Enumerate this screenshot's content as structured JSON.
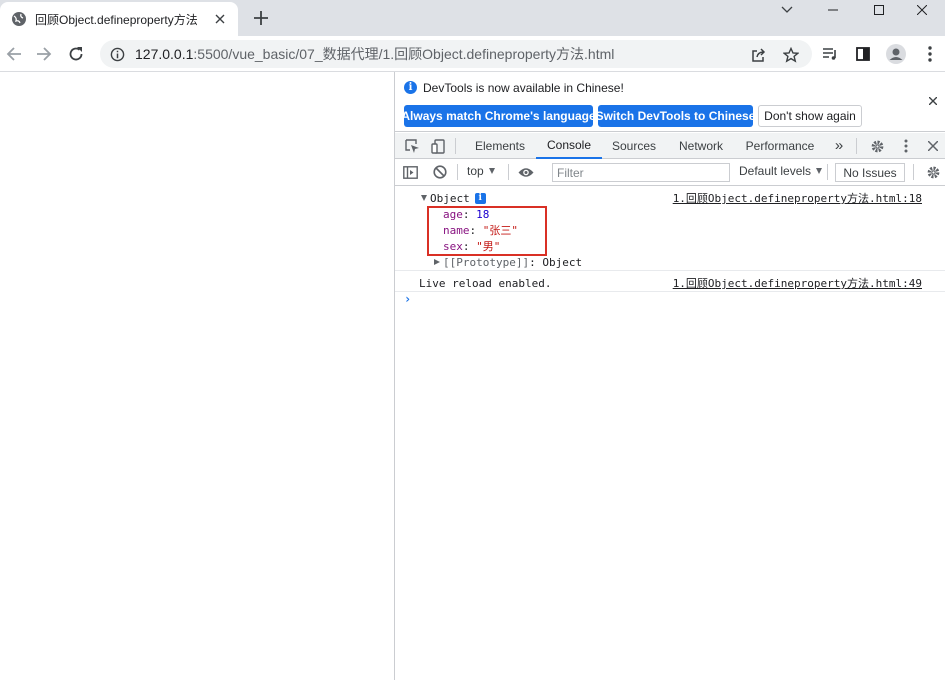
{
  "browser": {
    "tab_title": "回顾Object.defineproperty方法",
    "url_host": "127.0.0.1",
    "url_path": ":5500/vue_basic/07_数据代理/1.回顾Object.defineproperty方法.html"
  },
  "devtools": {
    "infobar": {
      "message": "DevTools is now available in Chinese!",
      "btn_match": "Always match Chrome's language",
      "btn_switch": "Switch DevTools to Chinese",
      "btn_dismiss": "Don't show again"
    },
    "tabs": [
      "Elements",
      "Console",
      "Sources",
      "Network",
      "Performance"
    ],
    "more_tabs": "»",
    "console_toolbar": {
      "context": "top",
      "filter_placeholder": "Filter",
      "levels": "Default levels",
      "issues": "No Issues"
    },
    "console": {
      "object_label": "Object",
      "info_badge": "i",
      "props": [
        {
          "key": "age",
          "value": "18",
          "kind": "num"
        },
        {
          "key": "name",
          "value": "\"张三\"",
          "kind": "str"
        },
        {
          "key": "sex",
          "value": "\"男\"",
          "kind": "str"
        }
      ],
      "prototype_key": "[[Prototype]]",
      "prototype_value": "Object",
      "source_1": "1.回顾Object.defineproperty方法.html:18",
      "live_reload": "Live reload enabled.",
      "source_2": "1.回顾Object.defineproperty方法.html:49",
      "prompt": "›"
    }
  }
}
